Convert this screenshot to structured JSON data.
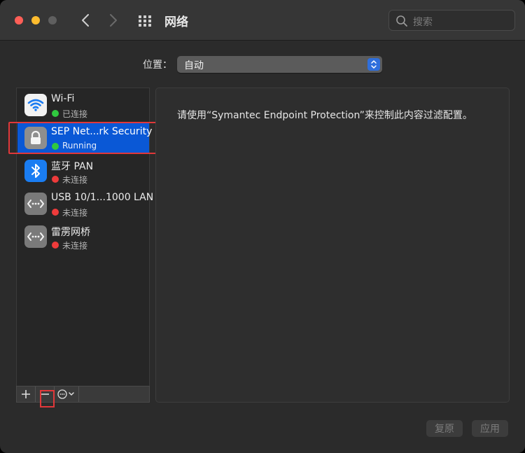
{
  "window": {
    "title": "网络"
  },
  "search": {
    "placeholder": "搜索"
  },
  "location": {
    "label": "位置：",
    "value": "自动"
  },
  "services": [
    {
      "name": "Wi-Fi",
      "status": "已连接",
      "status_color": "#30c93f",
      "icon": "wifi-icon",
      "selected": false
    },
    {
      "name": "SEP Net...rk Security",
      "status": "Running",
      "status_color": "#30c93f",
      "icon": "lock-icon",
      "selected": true
    },
    {
      "name": "蓝牙 PAN",
      "status": "未连接",
      "status_color": "#ee3b3b",
      "icon": "bluetooth-icon",
      "selected": false
    },
    {
      "name": "USB 10/1...1000 LAN",
      "status": "未连接",
      "status_color": "#ee3b3b",
      "icon": "ethernet-icon",
      "selected": false
    },
    {
      "name": "雷雳网桥",
      "status": "未连接",
      "status_color": "#ee3b3b",
      "icon": "ethernet-icon",
      "selected": false
    }
  ],
  "detail": {
    "message": "请使用“Symantec Endpoint Protection”来控制此内容过滤配置。"
  },
  "footer": {
    "revert_label": "复原",
    "apply_label": "应用"
  },
  "colors": {
    "accent": "#0a58d6",
    "annotation": "#e0383a"
  }
}
